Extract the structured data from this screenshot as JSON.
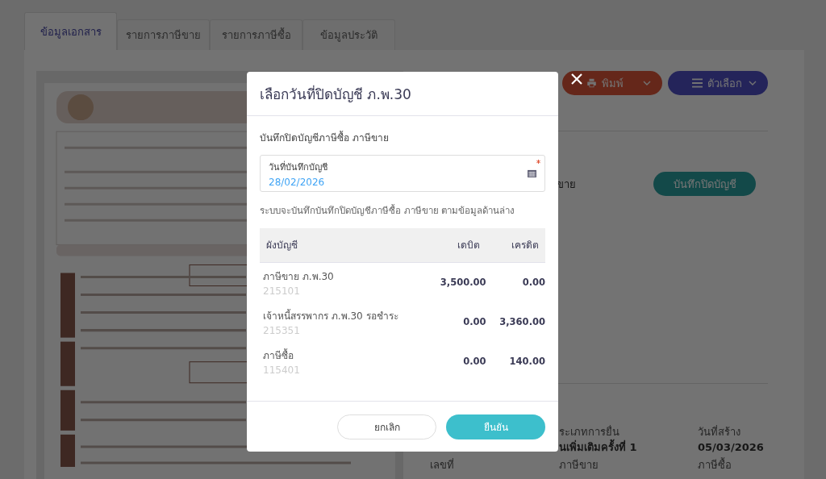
{
  "tabs": [
    {
      "label": "ข้อมูลเอกสาร",
      "selected": true
    },
    {
      "label": "รายการภาษีขาย",
      "selected": false
    },
    {
      "label": "รายการภาษีซื้อ",
      "selected": false
    },
    {
      "label": "ข้อมูลประวัติ",
      "selected": false
    }
  ],
  "toolbar": {
    "print_button": "พิมพ์",
    "options_button": "ตัวเลือก"
  },
  "close_account_row": {
    "label": "ขาย",
    "button": "บันทึกปิดบัญชี"
  },
  "details": {
    "fields": [
      {
        "label": "ระเภทการยื่น",
        "value": "นเพิ่มเติมครั้งที่ 1"
      },
      {
        "label": "วันที่สร้าง",
        "value": "05/03/2026"
      }
    ],
    "labels": [
      "เลขที่",
      "ภาษีขาย",
      "ภาษีซื้อ"
    ]
  },
  "dialog": {
    "title": "เลือกวันที่ปิดบัญชี ภ.พ.30",
    "section_title": "บันทึกปิดบัญชีภาษีซื้อ ภาษีขาย",
    "date_field": {
      "label": "วันที่บันทึกบัญชี",
      "value": "28/02/2026",
      "required": true
    },
    "note": "ระบบจะบันทึกบันทึกปิดบัญชีภาษีซื้อ ภาษีขาย ตามข้อมูลด้านล่าง",
    "table": {
      "columns": [
        "ผังบัญชี",
        "เดบิต",
        "เครดิต"
      ],
      "rows": [
        {
          "name": "ภาษีขาย ภ.พ.30",
          "code": "215101",
          "debit": "3,500.00",
          "credit": "0.00"
        },
        {
          "name": "เจ้าหนี้สรรพากร ภ.พ.30 รอชำระ",
          "code": "215351",
          "debit": "0.00",
          "credit": "3,360.00"
        },
        {
          "name": "ภาษีซื้อ",
          "code": "115401",
          "debit": "0.00",
          "credit": "140.00"
        }
      ]
    },
    "cancel_button": "ยกเลิก",
    "confirm_button": "ยืนยัน"
  }
}
